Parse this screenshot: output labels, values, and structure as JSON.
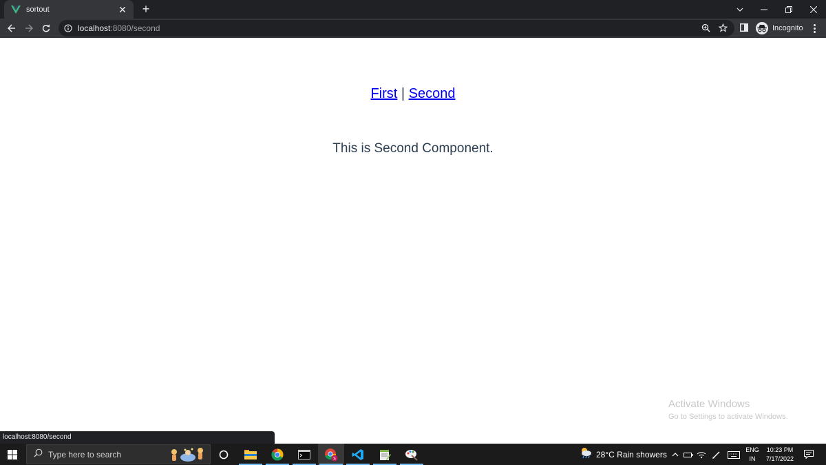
{
  "browser": {
    "tab": {
      "title": "sortout",
      "favicon": "vue-logo-icon"
    },
    "address": {
      "host": "localhost",
      "rest": ":8080/second"
    },
    "profile": {
      "label": "Incognito"
    }
  },
  "page": {
    "nav": {
      "first": "First",
      "separator": "|",
      "second": "Second"
    },
    "message": "This is Second Component."
  },
  "watermark": {
    "title": "Activate Windows",
    "subtitle": "Go to Settings to activate Windows."
  },
  "status_bar": {
    "url": "localhost:8080/second"
  },
  "taskbar": {
    "search_placeholder": "Type here to search",
    "weather": "28°C  Rain showers",
    "language": {
      "line1": "ENG",
      "line2": "IN"
    },
    "clock": {
      "time": "10:23 PM",
      "date": "7/17/2022"
    }
  },
  "colors": {
    "link": "#0000ee",
    "text": "#2c3e50",
    "chrome_dark": "#202124",
    "chrome_toolbar": "#35363a",
    "vue_green": "#41b883"
  }
}
